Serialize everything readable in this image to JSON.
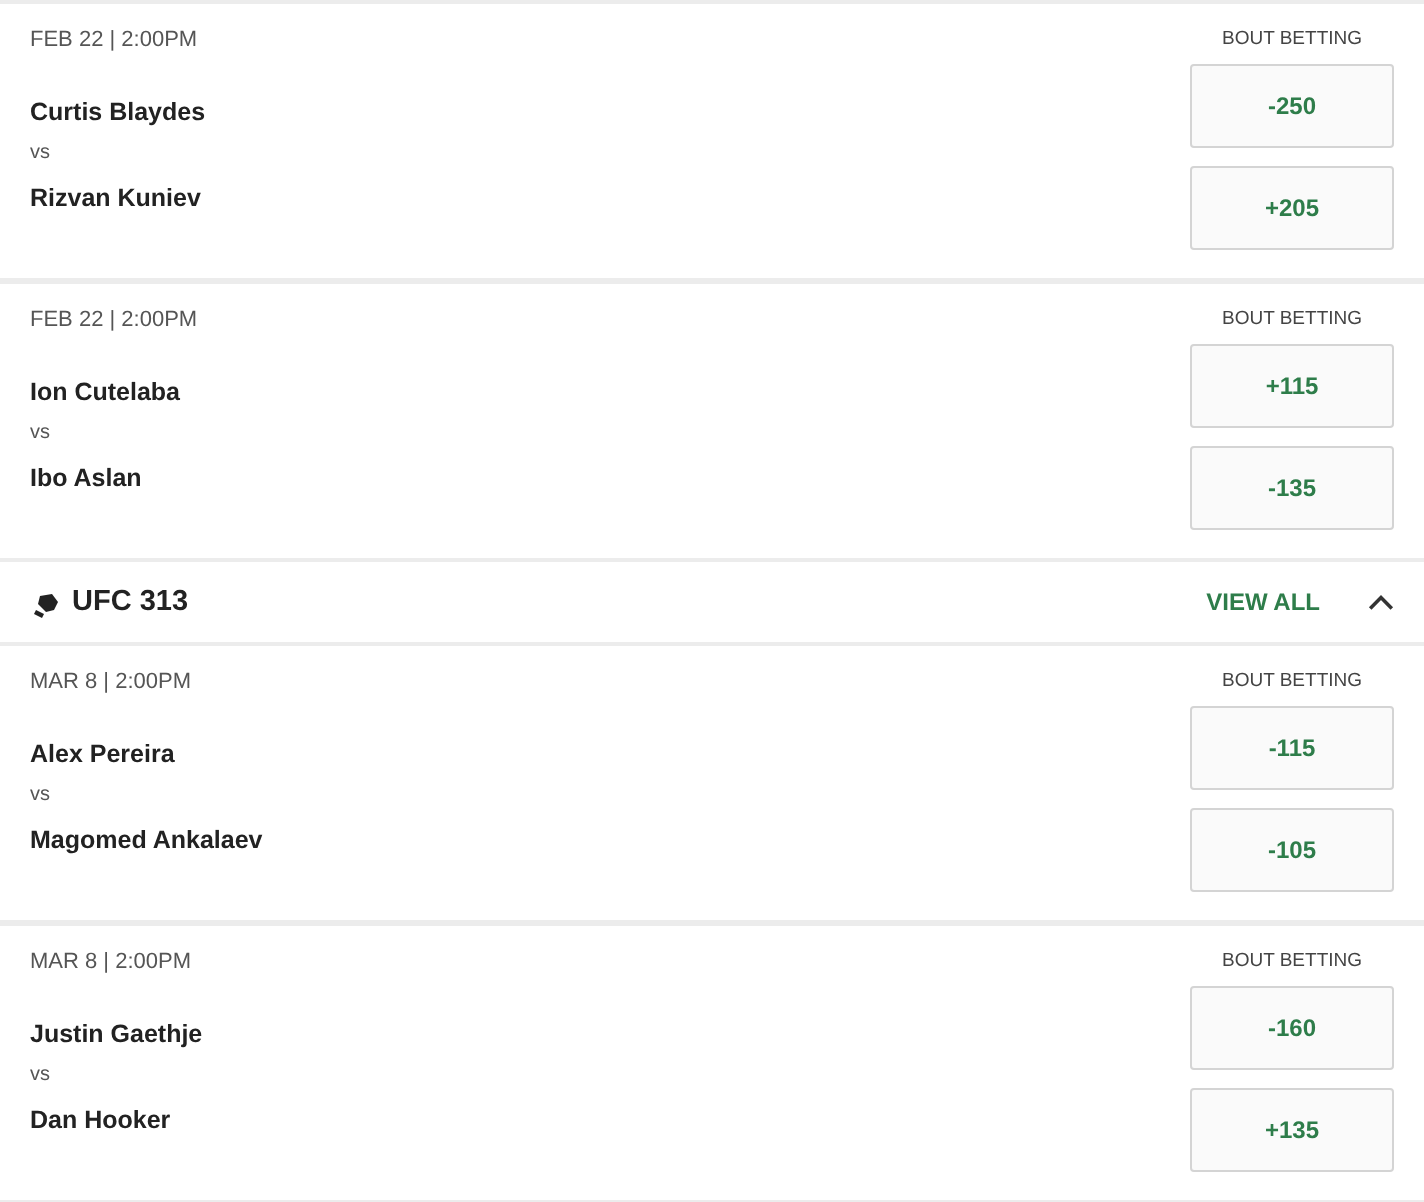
{
  "items": [
    {
      "kind": "bout",
      "date": "FEB 22 | 2:00PM",
      "market": "BOUT BETTING",
      "fighter_1": "Curtis Blaydes",
      "vs": "vs",
      "fighter_2": "Rizvan Kuniev",
      "odds_1": "-250",
      "odds_2": "+205"
    },
    {
      "kind": "bout",
      "date": "FEB 22 | 2:00PM",
      "market": "BOUT BETTING",
      "fighter_1": "Ion Cutelaba",
      "vs": "vs",
      "fighter_2": "Ibo Aslan",
      "odds_1": "+115",
      "odds_2": "-135"
    },
    {
      "kind": "event",
      "title": "UFC 313",
      "link": "VIEW ALL",
      "expanded": true
    },
    {
      "kind": "bout",
      "date": "MAR 8 | 2:00PM",
      "market": "BOUT BETTING",
      "fighter_1": "Alex Pereira",
      "vs": "vs",
      "fighter_2": "Magomed Ankalaev",
      "odds_1": "-115",
      "odds_2": "-105"
    },
    {
      "kind": "bout",
      "date": "MAR 8 | 2:00PM",
      "market": "BOUT BETTING",
      "fighter_1": "Justin Gaethje",
      "vs": "vs",
      "fighter_2": "Dan Hooker",
      "odds_1": "-160",
      "odds_2": "+135"
    }
  ]
}
